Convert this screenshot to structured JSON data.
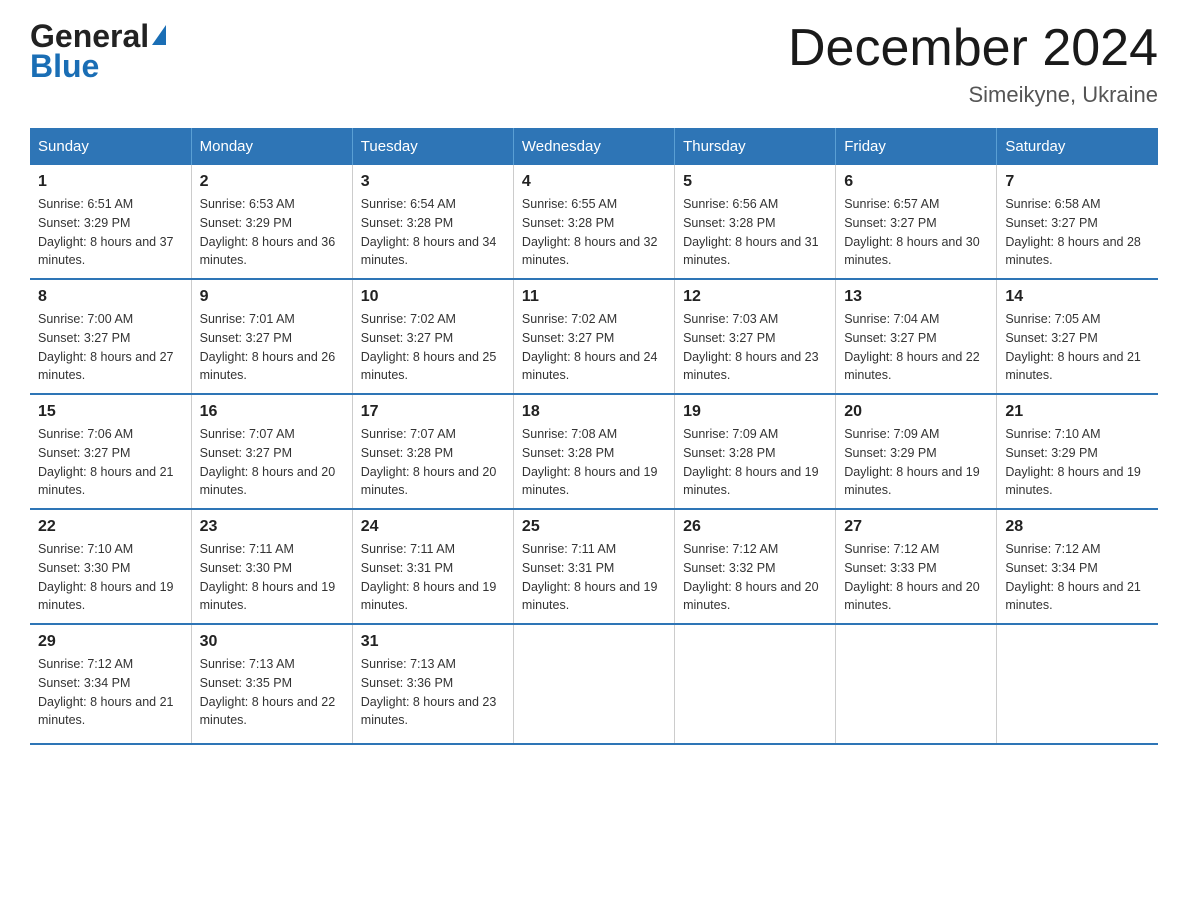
{
  "header": {
    "logo_line1": "General",
    "logo_line2": "Blue",
    "main_title": "December 2024",
    "subtitle": "Simeikyne, Ukraine"
  },
  "calendar": {
    "days_of_week": [
      "Sunday",
      "Monday",
      "Tuesday",
      "Wednesday",
      "Thursday",
      "Friday",
      "Saturday"
    ],
    "weeks": [
      [
        {
          "day": "1",
          "sunrise": "6:51 AM",
          "sunset": "3:29 PM",
          "daylight": "8 hours and 37 minutes."
        },
        {
          "day": "2",
          "sunrise": "6:53 AM",
          "sunset": "3:29 PM",
          "daylight": "8 hours and 36 minutes."
        },
        {
          "day": "3",
          "sunrise": "6:54 AM",
          "sunset": "3:28 PM",
          "daylight": "8 hours and 34 minutes."
        },
        {
          "day": "4",
          "sunrise": "6:55 AM",
          "sunset": "3:28 PM",
          "daylight": "8 hours and 32 minutes."
        },
        {
          "day": "5",
          "sunrise": "6:56 AM",
          "sunset": "3:28 PM",
          "daylight": "8 hours and 31 minutes."
        },
        {
          "day": "6",
          "sunrise": "6:57 AM",
          "sunset": "3:27 PM",
          "daylight": "8 hours and 30 minutes."
        },
        {
          "day": "7",
          "sunrise": "6:58 AM",
          "sunset": "3:27 PM",
          "daylight": "8 hours and 28 minutes."
        }
      ],
      [
        {
          "day": "8",
          "sunrise": "7:00 AM",
          "sunset": "3:27 PM",
          "daylight": "8 hours and 27 minutes."
        },
        {
          "day": "9",
          "sunrise": "7:01 AM",
          "sunset": "3:27 PM",
          "daylight": "8 hours and 26 minutes."
        },
        {
          "day": "10",
          "sunrise": "7:02 AM",
          "sunset": "3:27 PM",
          "daylight": "8 hours and 25 minutes."
        },
        {
          "day": "11",
          "sunrise": "7:02 AM",
          "sunset": "3:27 PM",
          "daylight": "8 hours and 24 minutes."
        },
        {
          "day": "12",
          "sunrise": "7:03 AM",
          "sunset": "3:27 PM",
          "daylight": "8 hours and 23 minutes."
        },
        {
          "day": "13",
          "sunrise": "7:04 AM",
          "sunset": "3:27 PM",
          "daylight": "8 hours and 22 minutes."
        },
        {
          "day": "14",
          "sunrise": "7:05 AM",
          "sunset": "3:27 PM",
          "daylight": "8 hours and 21 minutes."
        }
      ],
      [
        {
          "day": "15",
          "sunrise": "7:06 AM",
          "sunset": "3:27 PM",
          "daylight": "8 hours and 21 minutes."
        },
        {
          "day": "16",
          "sunrise": "7:07 AM",
          "sunset": "3:27 PM",
          "daylight": "8 hours and 20 minutes."
        },
        {
          "day": "17",
          "sunrise": "7:07 AM",
          "sunset": "3:28 PM",
          "daylight": "8 hours and 20 minutes."
        },
        {
          "day": "18",
          "sunrise": "7:08 AM",
          "sunset": "3:28 PM",
          "daylight": "8 hours and 19 minutes."
        },
        {
          "day": "19",
          "sunrise": "7:09 AM",
          "sunset": "3:28 PM",
          "daylight": "8 hours and 19 minutes."
        },
        {
          "day": "20",
          "sunrise": "7:09 AM",
          "sunset": "3:29 PM",
          "daylight": "8 hours and 19 minutes."
        },
        {
          "day": "21",
          "sunrise": "7:10 AM",
          "sunset": "3:29 PM",
          "daylight": "8 hours and 19 minutes."
        }
      ],
      [
        {
          "day": "22",
          "sunrise": "7:10 AM",
          "sunset": "3:30 PM",
          "daylight": "8 hours and 19 minutes."
        },
        {
          "day": "23",
          "sunrise": "7:11 AM",
          "sunset": "3:30 PM",
          "daylight": "8 hours and 19 minutes."
        },
        {
          "day": "24",
          "sunrise": "7:11 AM",
          "sunset": "3:31 PM",
          "daylight": "8 hours and 19 minutes."
        },
        {
          "day": "25",
          "sunrise": "7:11 AM",
          "sunset": "3:31 PM",
          "daylight": "8 hours and 19 minutes."
        },
        {
          "day": "26",
          "sunrise": "7:12 AM",
          "sunset": "3:32 PM",
          "daylight": "8 hours and 20 minutes."
        },
        {
          "day": "27",
          "sunrise": "7:12 AM",
          "sunset": "3:33 PM",
          "daylight": "8 hours and 20 minutes."
        },
        {
          "day": "28",
          "sunrise": "7:12 AM",
          "sunset": "3:34 PM",
          "daylight": "8 hours and 21 minutes."
        }
      ],
      [
        {
          "day": "29",
          "sunrise": "7:12 AM",
          "sunset": "3:34 PM",
          "daylight": "8 hours and 21 minutes."
        },
        {
          "day": "30",
          "sunrise": "7:13 AM",
          "sunset": "3:35 PM",
          "daylight": "8 hours and 22 minutes."
        },
        {
          "day": "31",
          "sunrise": "7:13 AM",
          "sunset": "3:36 PM",
          "daylight": "8 hours and 23 minutes."
        },
        null,
        null,
        null,
        null
      ]
    ]
  }
}
